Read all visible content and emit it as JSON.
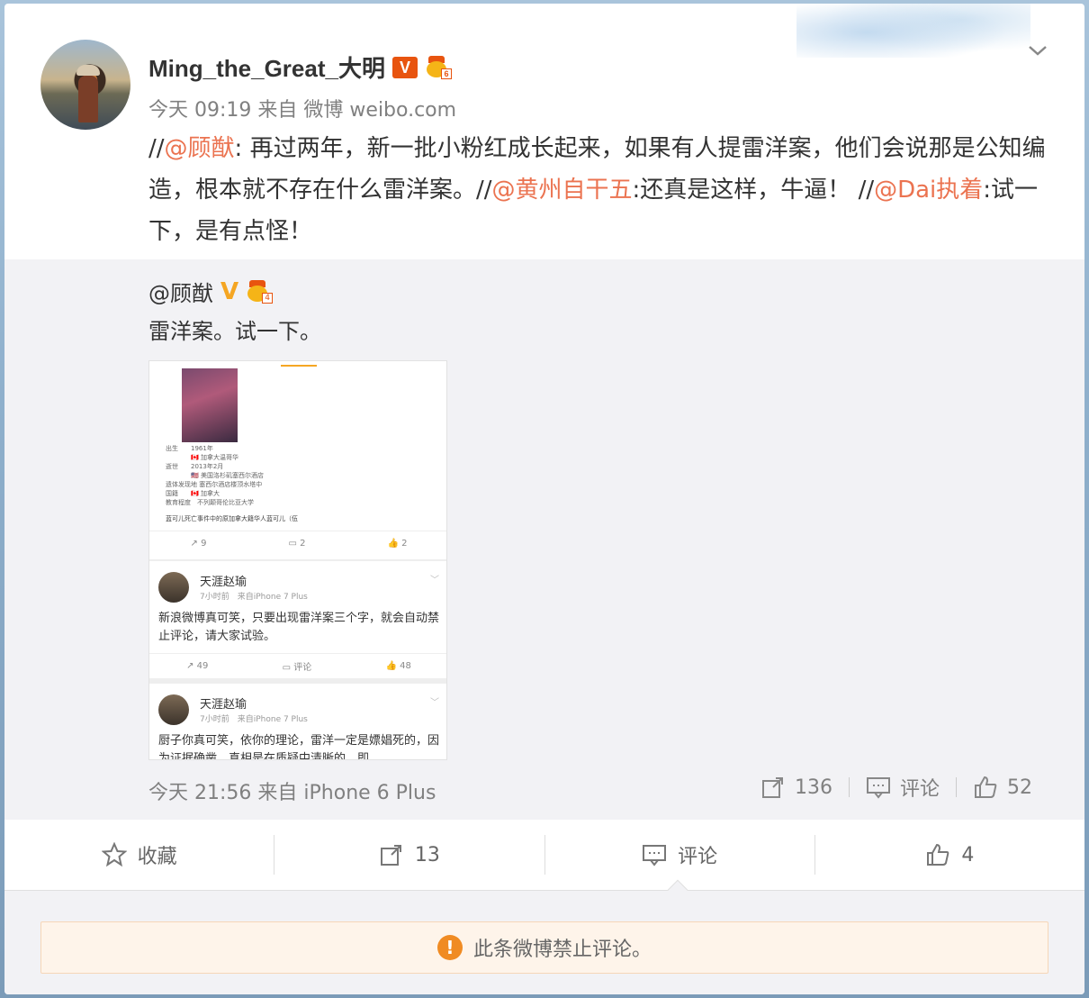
{
  "post": {
    "username": "Ming_the_Great_大明",
    "verified_badge": "V",
    "member_level": "6",
    "time": "今天 09:19",
    "source_prefix": "来自",
    "source": "微博 weibo.com",
    "content": [
      {
        "type": "text",
        "value": "//"
      },
      {
        "type": "mention",
        "value": "@顾猷"
      },
      {
        "type": "text",
        "value": ": 再过两年，新一批小粉红成长起来，如果有人提雷洋案，他们会说那是公知编造，根本就不存在什么雷洋案。//"
      },
      {
        "type": "mention",
        "value": "@黄州自干五"
      },
      {
        "type": "text",
        "value": ":还真是这样，牛逼！ //"
      },
      {
        "type": "mention",
        "value": "@Dai执着"
      },
      {
        "type": "text",
        "value": ":试一下，是有点怪！"
      }
    ]
  },
  "repost": {
    "original_user": "@顾猷",
    "verified_badge": "V",
    "member_level": "4",
    "text": "雷洋案。试一下。",
    "time": "今天 21:56",
    "source_prefix": "来自",
    "source": "iPhone 6 Plus",
    "stats": {
      "reposts": "136",
      "comment_label": "评论",
      "likes": "52"
    }
  },
  "thumbnail": {
    "lines": [
      "出生　　1961年",
      "　　　　🇨🇦 加拿大温哥华",
      "逝世　　2013年2月",
      "　　　　🇺🇸 美国洛杉矶塞西尔酒店",
      "遗体发现地 塞西尔酒店楼顶水塔中",
      "国籍　　🇨🇦 加拿大",
      "教育程度　不列颠哥伦比亚大学"
    ],
    "caption": "蓝可儿死亡事件中的原加拿大籍华人蓝可儿（伍",
    "actions": [
      "9",
      "2",
      "2"
    ],
    "posts": [
      {
        "name": "天涯赵瑜",
        "meta": "7小时前　来自iPhone 7 Plus",
        "text": "新浪微博真可笑，只要出现雷洋案三个字，就会自动禁止评论，请大家试验。",
        "actions": [
          "49",
          "评论",
          "48"
        ]
      },
      {
        "name": "天涯赵瑜",
        "meta": "7小时前　来自iPhone 7 Plus",
        "text": "厨子你真可笑，依你的理论，雷洋一定是嫖娼死的，因为证据确凿，真相是在质疑中清晰的，即"
      }
    ]
  },
  "actions": {
    "favorite": "收藏",
    "repost_count": "13",
    "comment": "评论",
    "like_count": "4"
  },
  "notice": {
    "icon": "!",
    "text": "此条微博禁止评论。"
  },
  "colors": {
    "mention": "#eb7350",
    "badge_orange": "#e8540f",
    "badge_yellow": "#f5a623",
    "notice_bg": "#fef4ea",
    "warn": "#f08b23"
  }
}
